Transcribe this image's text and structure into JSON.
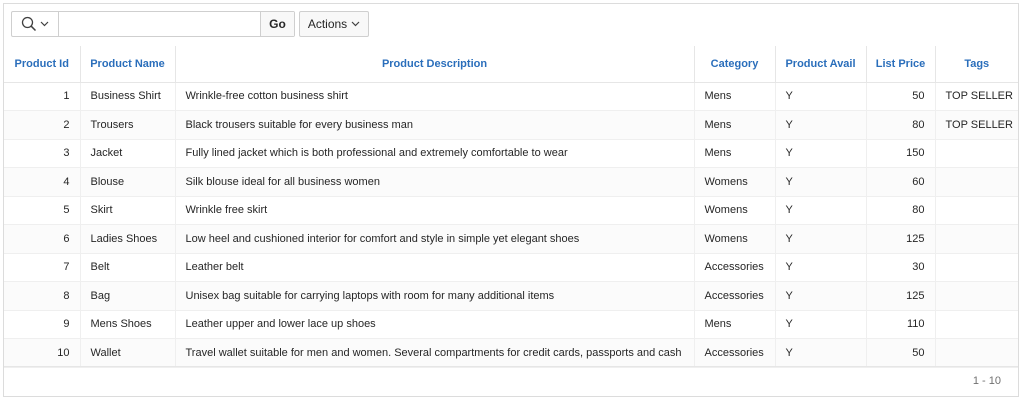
{
  "toolbar": {
    "search_value": "",
    "search_placeholder": "",
    "go_label": "Go",
    "actions_label": "Actions",
    "search_icon": "search-icon",
    "chevron_icon": "chevron-down-icon"
  },
  "table": {
    "headers": [
      "Product Id",
      "Product Name",
      "Product Description",
      "Category",
      "Product Avail",
      "List Price",
      "Tags"
    ],
    "rows": [
      {
        "id": "1",
        "name": "Business Shirt",
        "description": "Wrinkle-free cotton business shirt",
        "category": "Mens",
        "avail": "Y",
        "price": "50",
        "tags": "TOP SELLER"
      },
      {
        "id": "2",
        "name": "Trousers",
        "description": "Black trousers suitable for every business man",
        "category": "Mens",
        "avail": "Y",
        "price": "80",
        "tags": "TOP SELLER"
      },
      {
        "id": "3",
        "name": "Jacket",
        "description": "Fully lined jacket which is both professional and extremely comfortable to wear",
        "category": "Mens",
        "avail": "Y",
        "price": "150",
        "tags": ""
      },
      {
        "id": "4",
        "name": "Blouse",
        "description": "Silk blouse ideal for all business women",
        "category": "Womens",
        "avail": "Y",
        "price": "60",
        "tags": ""
      },
      {
        "id": "5",
        "name": "Skirt",
        "description": "Wrinkle free skirt",
        "category": "Womens",
        "avail": "Y",
        "price": "80",
        "tags": ""
      },
      {
        "id": "6",
        "name": "Ladies Shoes",
        "description": "Low heel and cushioned interior for comfort and style in simple yet elegant shoes",
        "category": "Womens",
        "avail": "Y",
        "price": "125",
        "tags": ""
      },
      {
        "id": "7",
        "name": "Belt",
        "description": "Leather belt",
        "category": "Accessories",
        "avail": "Y",
        "price": "30",
        "tags": ""
      },
      {
        "id": "8",
        "name": "Bag",
        "description": "Unisex bag suitable for carrying laptops with room for many additional items",
        "category": "Accessories",
        "avail": "Y",
        "price": "125",
        "tags": ""
      },
      {
        "id": "9",
        "name": "Mens Shoes",
        "description": "Leather upper and lower lace up shoes",
        "category": "Mens",
        "avail": "Y",
        "price": "110",
        "tags": ""
      },
      {
        "id": "10",
        "name": "Wallet",
        "description": "Travel wallet suitable for men and women. Several compartments for credit cards, passports and cash",
        "category": "Accessories",
        "avail": "Y",
        "price": "50",
        "tags": ""
      }
    ]
  },
  "footer": {
    "pagination": "1 - 10"
  },
  "colors": {
    "header_text": "#2a6ebb",
    "border": "#e6e6e6"
  }
}
